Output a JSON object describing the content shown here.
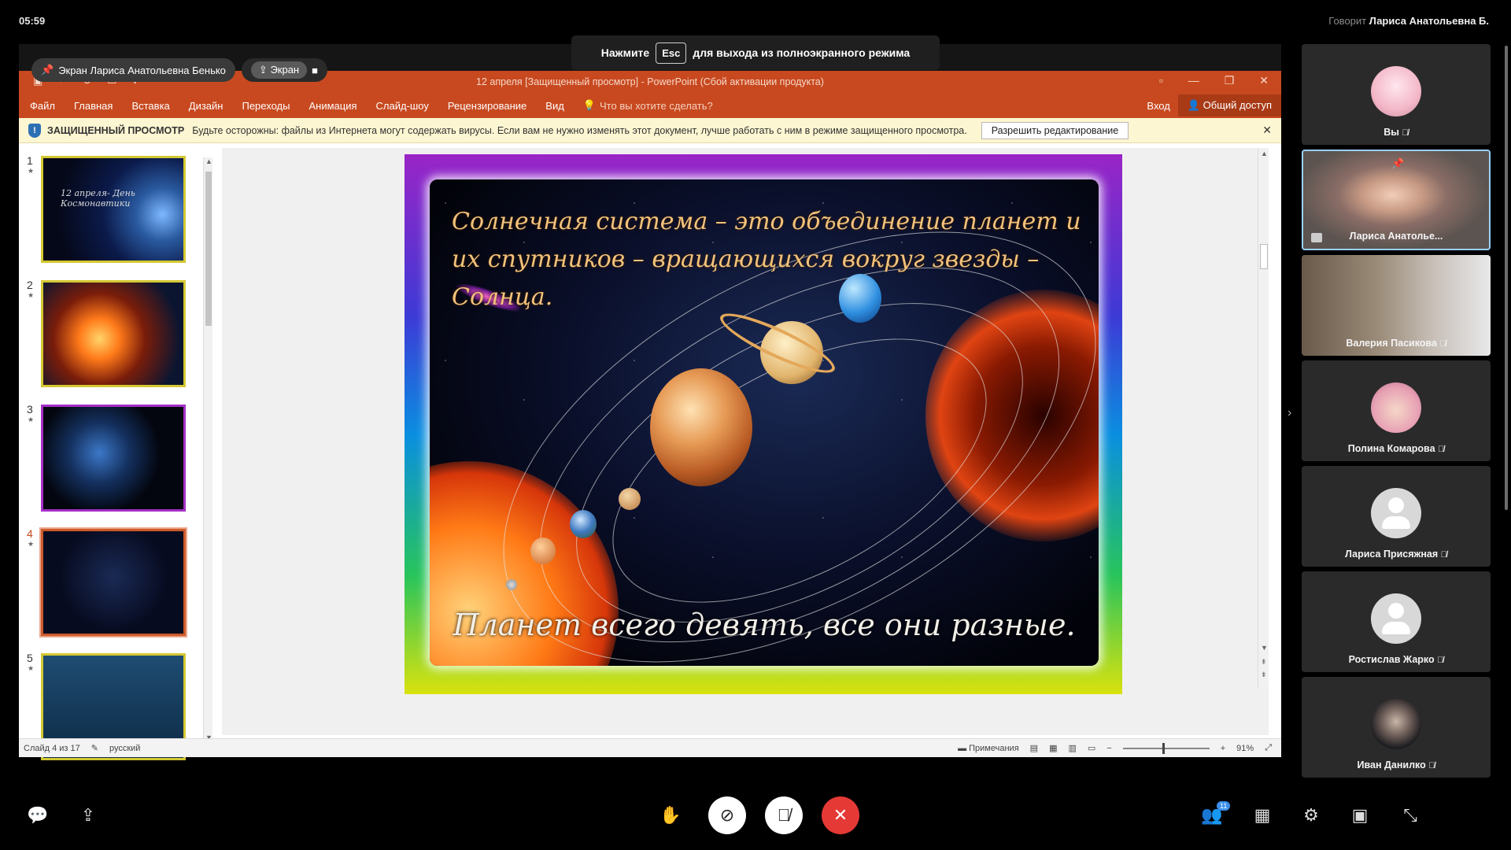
{
  "topbar": {
    "clock": "05:59",
    "speaker_label": "Говорит",
    "speaker_name": "Лариса Анатольевна Б."
  },
  "fullscreen_banner": {
    "press": "Нажмите",
    "key": "Esc",
    "rest": "для выхода из полноэкранного режима"
  },
  "share_pills": {
    "presenter": "Экран Лариса Анатольевна Бенько",
    "screen": "Экран"
  },
  "powerpoint": {
    "window_title": "12 апреля [Защищенный просмотр] - PowerPoint (Сбой активации продукта)",
    "ribbon_tabs": [
      "Файл",
      "Главная",
      "Вставка",
      "Дизайн",
      "Переходы",
      "Анимация",
      "Слайд-шоу",
      "Рецензирование",
      "Вид"
    ],
    "search_placeholder": "Что вы хотите сделать?",
    "signin": "Вход",
    "share": "Общий доступ",
    "protected_view": {
      "label": "ЗАЩИЩЕННЫЙ ПРОСМОТР",
      "message": "Будьте осторожны: файлы из Интернета могут содержать вирусы. Если вам не нужно изменять этот документ, лучше работать с ним в режиме защищенного просмотра.",
      "button": "Разрешить редактирование"
    },
    "thumbnails": [
      {
        "num": "1",
        "title": "12 апреля- День Космонавтики"
      },
      {
        "num": "2",
        "title": ""
      },
      {
        "num": "3",
        "title": ""
      },
      {
        "num": "4",
        "title": ""
      },
      {
        "num": "5",
        "title": ""
      }
    ],
    "slide": {
      "heading": "Солнечная система – это объединение планет и их спутников – вращающихся вокруг звезды – Солнца.",
      "footer": "Планет всего девять, все они разные."
    },
    "status": {
      "slide_info": "Слайд 4 из 17",
      "language": "русский",
      "notes": "Примечания",
      "zoom": "91%"
    }
  },
  "participants": [
    {
      "name": "Вы",
      "kind": "photo-avatar"
    },
    {
      "name": "Лариса Анатолье...",
      "kind": "video",
      "pinned": true,
      "sharing": true
    },
    {
      "name": "Валерия Пасикова",
      "kind": "video"
    },
    {
      "name": "Полина Комарова",
      "kind": "photo-avatar"
    },
    {
      "name": "Лариса Присяжная",
      "kind": "default-avatar"
    },
    {
      "name": "Ростислав Жарко",
      "kind": "default-avatar"
    },
    {
      "name": "Иван Данилко",
      "kind": "photo-avatar"
    }
  ],
  "controls": {
    "participants_count": "11"
  },
  "colors": {
    "ppt_accent": "#c8491f",
    "end_call": "#e53935"
  }
}
